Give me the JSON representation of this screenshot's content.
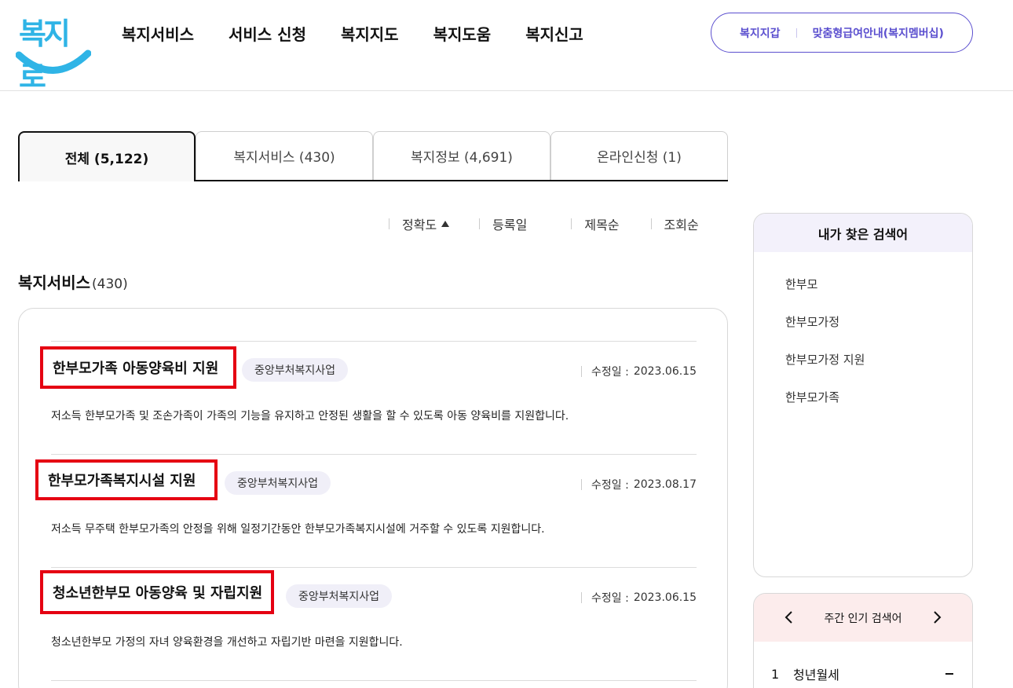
{
  "header": {
    "logo_text": "복지로",
    "nav": [
      "복지서비스",
      "서비스 신청",
      "복지지도",
      "복지도움",
      "복지신고"
    ],
    "links": [
      "복지지갑",
      "맞춤형급여안내(복지멤버십)"
    ]
  },
  "tabs": [
    {
      "label": "전체  (5,122)",
      "active": true
    },
    {
      "label": "복지서비스 (430)",
      "active": false
    },
    {
      "label": "복지정보 (4,691)",
      "active": false
    },
    {
      "label": "온라인신청 (1)",
      "active": false
    }
  ],
  "sort": [
    {
      "label": "정확도",
      "active": true
    },
    {
      "label": "등록일"
    },
    {
      "label": "제목순"
    },
    {
      "label": "조회순"
    }
  ],
  "section": {
    "title": "복지서비스",
    "count": "(430)"
  },
  "results": [
    {
      "title": "한부모가족 아동양육비 지원",
      "badge": "중앙부처복지사업",
      "date_label": "수정일 :",
      "date": "2023.06.15",
      "desc": "저소득 한부모가족 및 조손가족이 가족의 기능을 유지하고 안정된 생활을 할 수 있도록 아동 양육비를 지원합니다."
    },
    {
      "title": "한부모가족복지시설 지원",
      "badge": "중앙부처복지사업",
      "date_label": "수정일 :",
      "date": "2023.08.17",
      "desc": "저소득 무주택 한부모가족의 안정을 위해 일정기간동안 한부모가족복지시설에 거주할 수 있도록 지원합니다."
    },
    {
      "title": "청소년한부모 아동양육 및 자립지원",
      "badge": "중앙부처복지사업",
      "date_label": "수정일 :",
      "date": "2023.06.15",
      "desc": "청소년한부모 가정의 자녀 양육환경을 개선하고 자립기반 마련을 지원합니다."
    }
  ],
  "my_searches": {
    "title": "내가 찾은 검색어",
    "keywords": [
      "한부모",
      "한부모가정",
      "한부모가정 지원",
      "한부모가족"
    ]
  },
  "popular": {
    "title": "주간 인기 검색어",
    "rows": [
      {
        "rank": "1",
        "keyword": "청년월세"
      }
    ]
  },
  "colors": {
    "accent": "#5b4fcf",
    "highlight_box": "#e50012",
    "logo": "#2fb4e6"
  }
}
